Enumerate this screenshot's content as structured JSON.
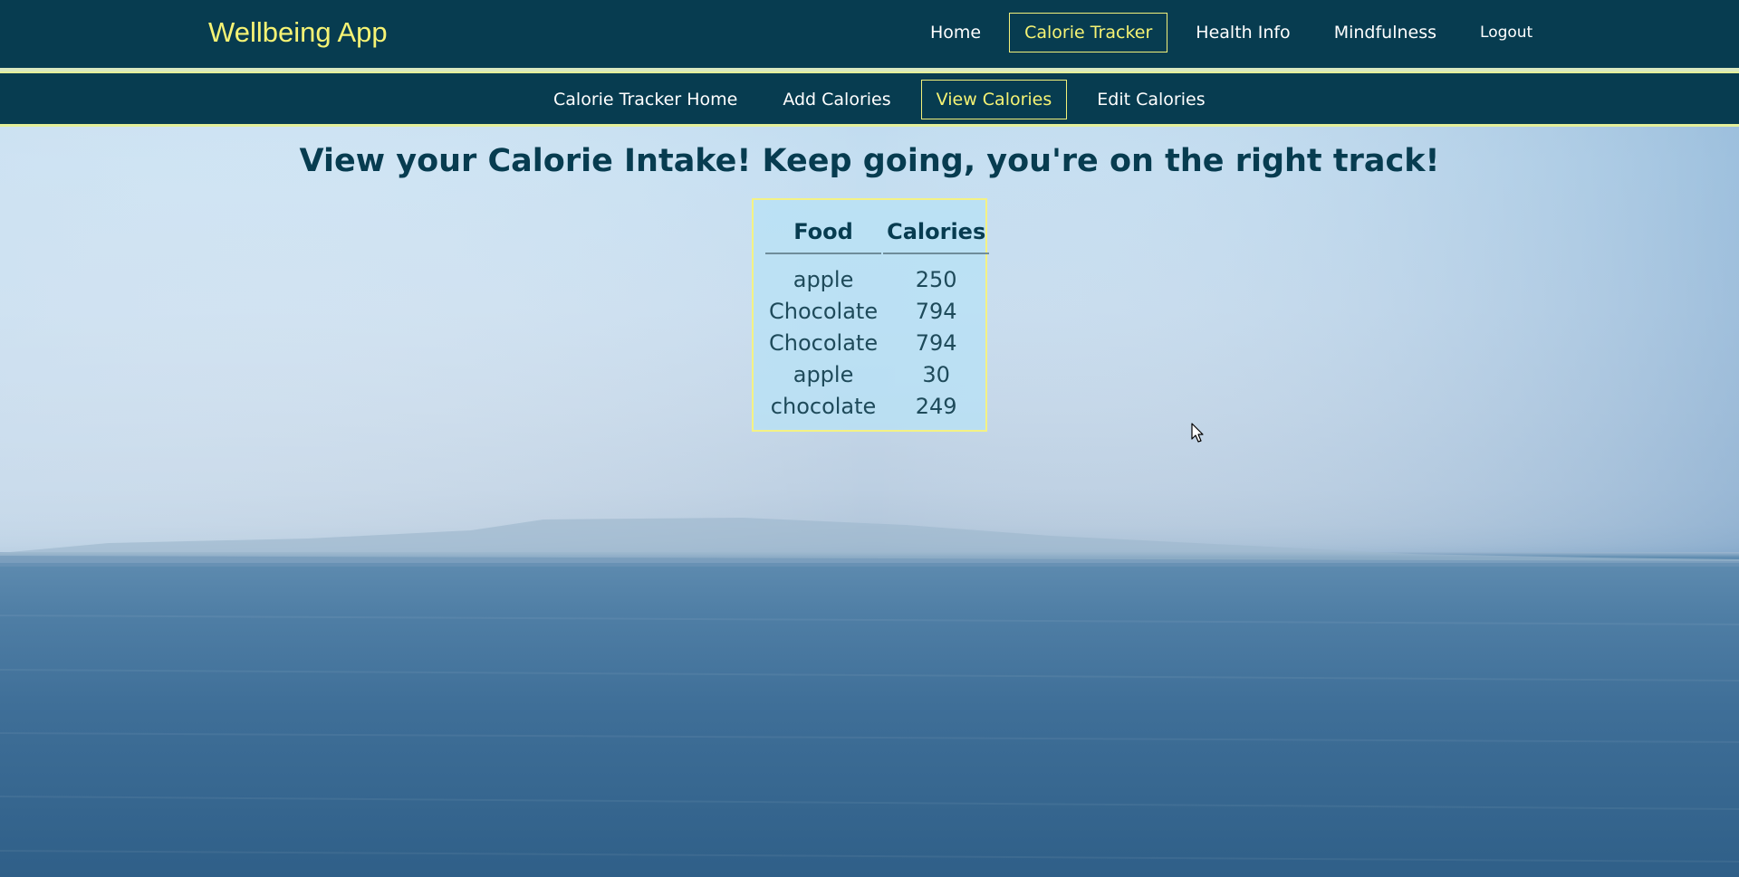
{
  "app": {
    "brand": "Wellbeing App"
  },
  "main_nav": {
    "items": [
      {
        "label": "Home",
        "active": false
      },
      {
        "label": "Calorie Tracker",
        "active": true
      },
      {
        "label": "Health Info",
        "active": false
      },
      {
        "label": "Mindfulness",
        "active": false
      },
      {
        "label": "Logout",
        "active": false
      }
    ]
  },
  "sub_nav": {
    "items": [
      {
        "label": "Calorie Tracker Home",
        "active": false
      },
      {
        "label": "Add Calories",
        "active": false
      },
      {
        "label": "View Calories",
        "active": true
      },
      {
        "label": "Edit Calories",
        "active": false
      }
    ]
  },
  "page": {
    "heading": "View your Calorie Intake! Keep going, you're on the right track!"
  },
  "calorie_table": {
    "headers": [
      "Food",
      "Calories"
    ],
    "rows": [
      {
        "food": "apple",
        "calories": "250"
      },
      {
        "food": "Chocolate",
        "calories": "794"
      },
      {
        "food": "Chocolate",
        "calories": "794"
      },
      {
        "food": "apple",
        "calories": "30"
      },
      {
        "food": "chocolate",
        "calories": "249"
      }
    ]
  },
  "colors": {
    "nav_bg": "#073c50",
    "accent_yellow": "#f6f374",
    "heading_text": "#073c50"
  },
  "icons": {
    "cursor": "mouse-pointer-icon"
  }
}
